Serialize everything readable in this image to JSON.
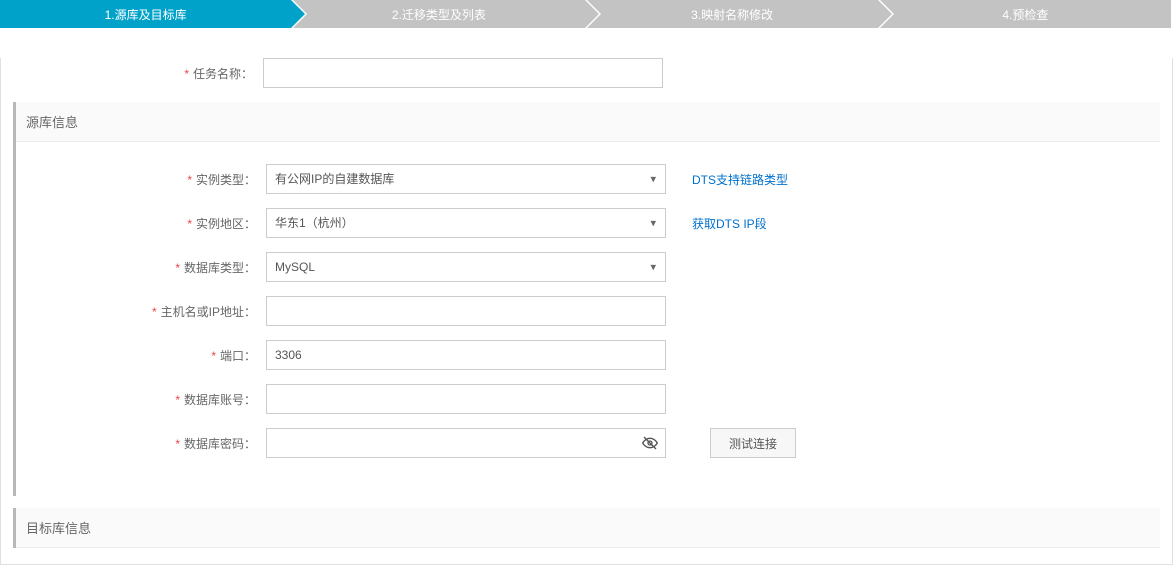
{
  "steps": [
    {
      "label": "1.源库及目标库",
      "active": true
    },
    {
      "label": "2.迁移类型及列表",
      "active": false
    },
    {
      "label": "3.映射名称修改",
      "active": false
    },
    {
      "label": "4.预检查",
      "active": false
    }
  ],
  "task_name": {
    "label": "任务名称：",
    "value": ""
  },
  "source_section": {
    "title": "源库信息",
    "fields": {
      "instance_type": {
        "label": "实例类型：",
        "value": "有公网IP的自建数据库",
        "link": "DTS支持链路类型"
      },
      "region": {
        "label": "实例地区：",
        "value": "华东1（杭州）",
        "link": "获取DTS IP段"
      },
      "db_type": {
        "label": "数据库类型：",
        "value": "MySQL"
      },
      "host": {
        "label": "主机名或IP地址：",
        "value": ""
      },
      "port": {
        "label": "端口：",
        "value": "3306"
      },
      "account": {
        "label": "数据库账号：",
        "value": ""
      },
      "password": {
        "label": "数据库密码：",
        "value": "",
        "test_btn": "测试连接"
      }
    }
  },
  "target_section": {
    "title": "目标库信息"
  }
}
